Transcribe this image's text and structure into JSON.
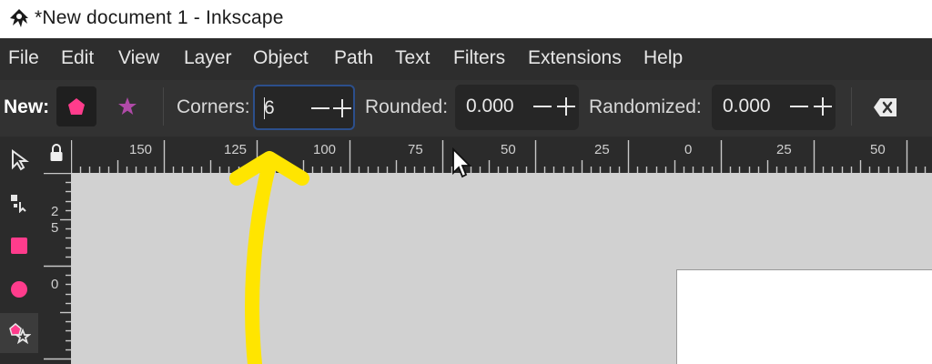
{
  "window": {
    "title": "*New document 1 - Inkscape"
  },
  "menu": [
    "File",
    "Edit",
    "View",
    "Layer",
    "Object",
    "Path",
    "Text",
    "Filters",
    "Extensions",
    "Help"
  ],
  "toolbar": {
    "new_label": "New:",
    "corners_label": "Corners:",
    "corners_value": "6",
    "rounded_label": "Rounded:",
    "rounded_value": "0.000",
    "randomized_label": "Randomized:",
    "randomized_value": "0.000"
  },
  "ruler": {
    "horizontal_labels": [
      "150",
      "125",
      "100",
      "75",
      "50",
      "25",
      "0",
      "25",
      "50"
    ],
    "vertical_labels": [
      "2",
      "5",
      "0"
    ]
  },
  "colors": {
    "accent_pink": "#ff3c8c",
    "star_purple": "#b04aa8",
    "annotation_yellow": "#ffe500"
  },
  "icons": {
    "polygon": "pentagon-icon",
    "star": "star-icon",
    "clear": "backspace-icon",
    "lock": "lock-icon"
  }
}
